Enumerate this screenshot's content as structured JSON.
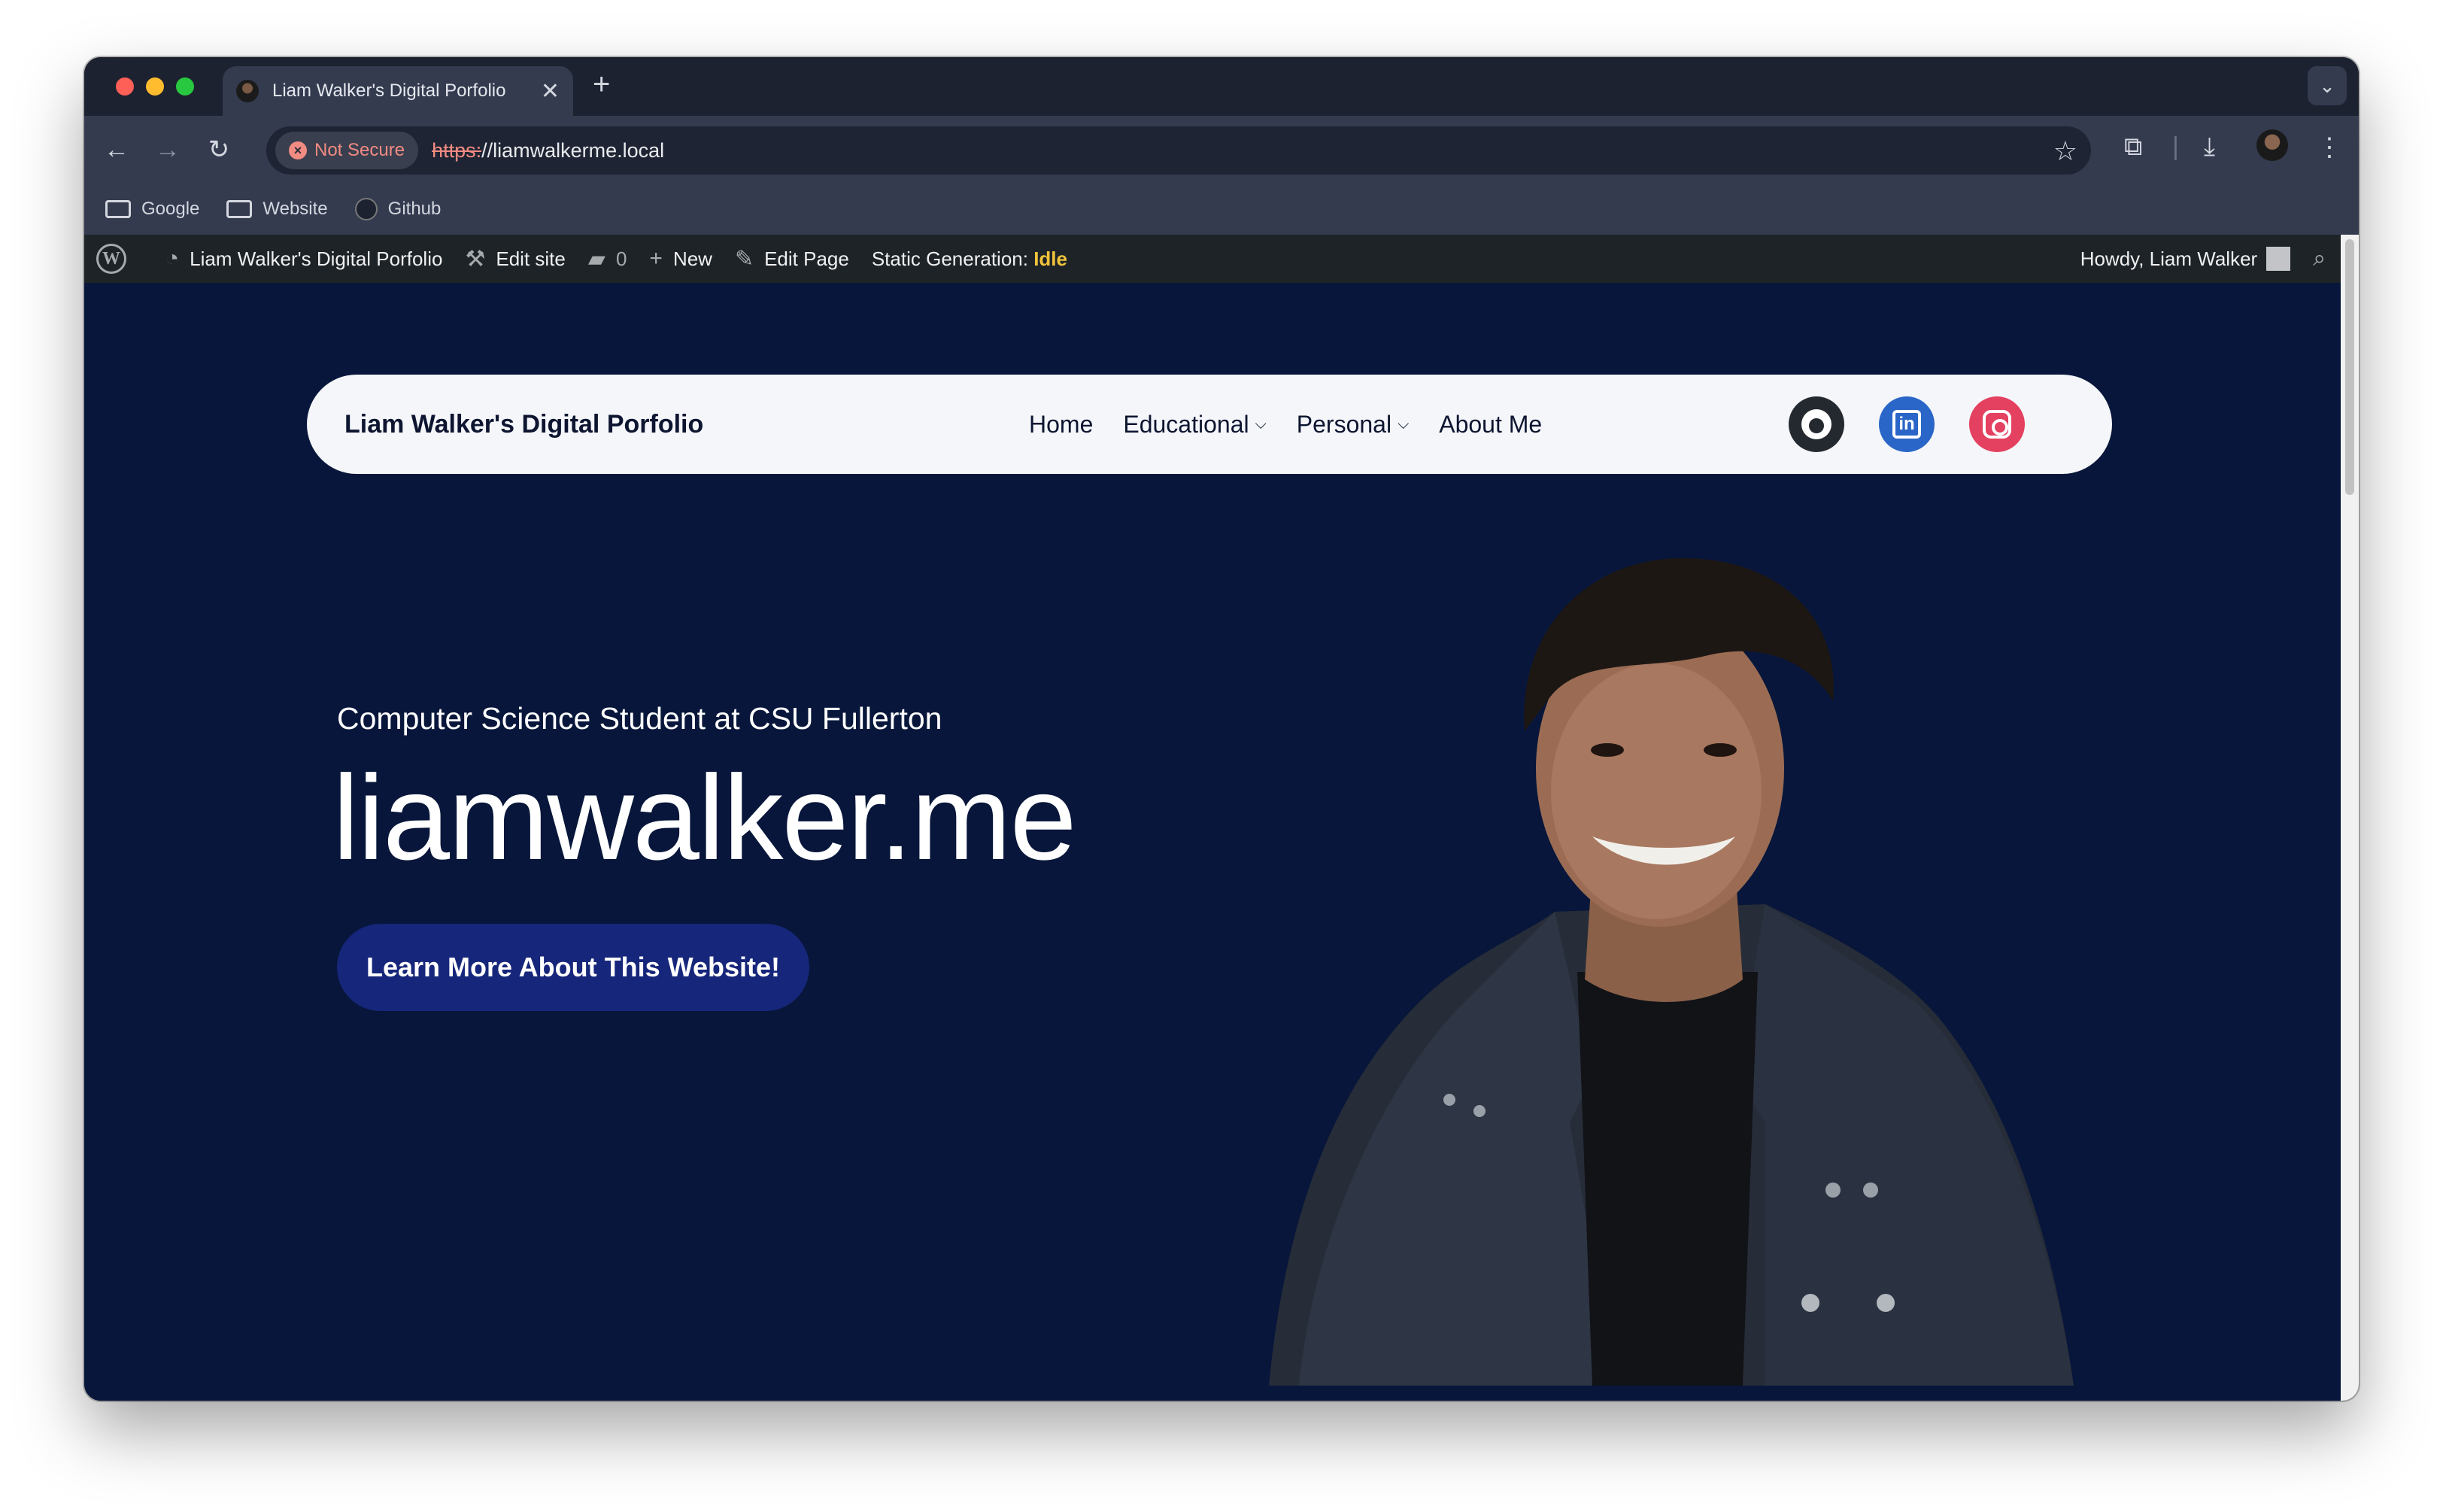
{
  "browser": {
    "tab_title": "Liam Walker's Digital Porfolio",
    "tab_close": "✕",
    "new_tab": "+",
    "security_label": "Not Secure",
    "url_scheme": "https:",
    "url_rest": "//liamwalkerme.local",
    "bookmarks": [
      "Google",
      "Website",
      "Github"
    ]
  },
  "adminbar": {
    "site_name": "Liam Walker's Digital Porfolio",
    "edit_site": "Edit site",
    "comments_count": "0",
    "new": "New",
    "edit_page": "Edit Page",
    "static_gen_label": "Static Generation:",
    "static_gen_status": "Idle",
    "howdy": "Howdy, Liam Walker"
  },
  "site": {
    "title": "Liam Walker's Digital Porfolio",
    "menu": [
      {
        "label": "Home",
        "has_dropdown": false
      },
      {
        "label": "Educational",
        "has_dropdown": true
      },
      {
        "label": "Personal",
        "has_dropdown": true
      },
      {
        "label": "About Me",
        "has_dropdown": false
      }
    ],
    "social": [
      "github-icon",
      "linkedin-icon",
      "instagram-icon"
    ]
  },
  "hero": {
    "subtitle": "Computer Science Student at CSU Fullerton",
    "headline": "liamwalker.me",
    "cta_label": "Learn More About This Website!"
  },
  "colors": {
    "background": "#07163a",
    "cta": "#16267a",
    "nav_bg": "#f4f6fa",
    "adminbar": "#1d2327",
    "idle": "#f0c33c"
  }
}
